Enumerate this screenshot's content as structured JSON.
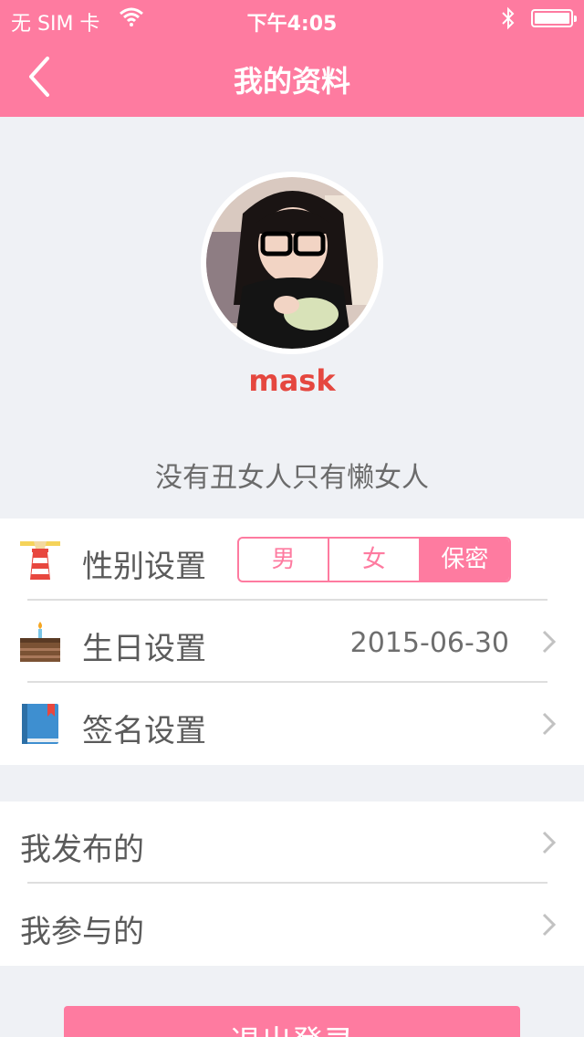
{
  "status_bar": {
    "carrier": "无 SIM 卡",
    "time": "下午4:05"
  },
  "nav": {
    "title": "我的资料"
  },
  "profile": {
    "username": "mask",
    "signature": "没有丑女人只有懒女人"
  },
  "settings": {
    "gender": {
      "label": "性别设置",
      "options": [
        "男",
        "女",
        "保密"
      ],
      "selected": "保密"
    },
    "birthday": {
      "label": "生日设置",
      "value": "2015-06-30"
    },
    "signature": {
      "label": "签名设置"
    }
  },
  "activity": {
    "published": "我发布的",
    "joined": "我参与的"
  },
  "logout_label": "退出登录",
  "colors": {
    "accent": "#fe7ba0",
    "username": "#e5473f",
    "background": "#eff1f5"
  }
}
